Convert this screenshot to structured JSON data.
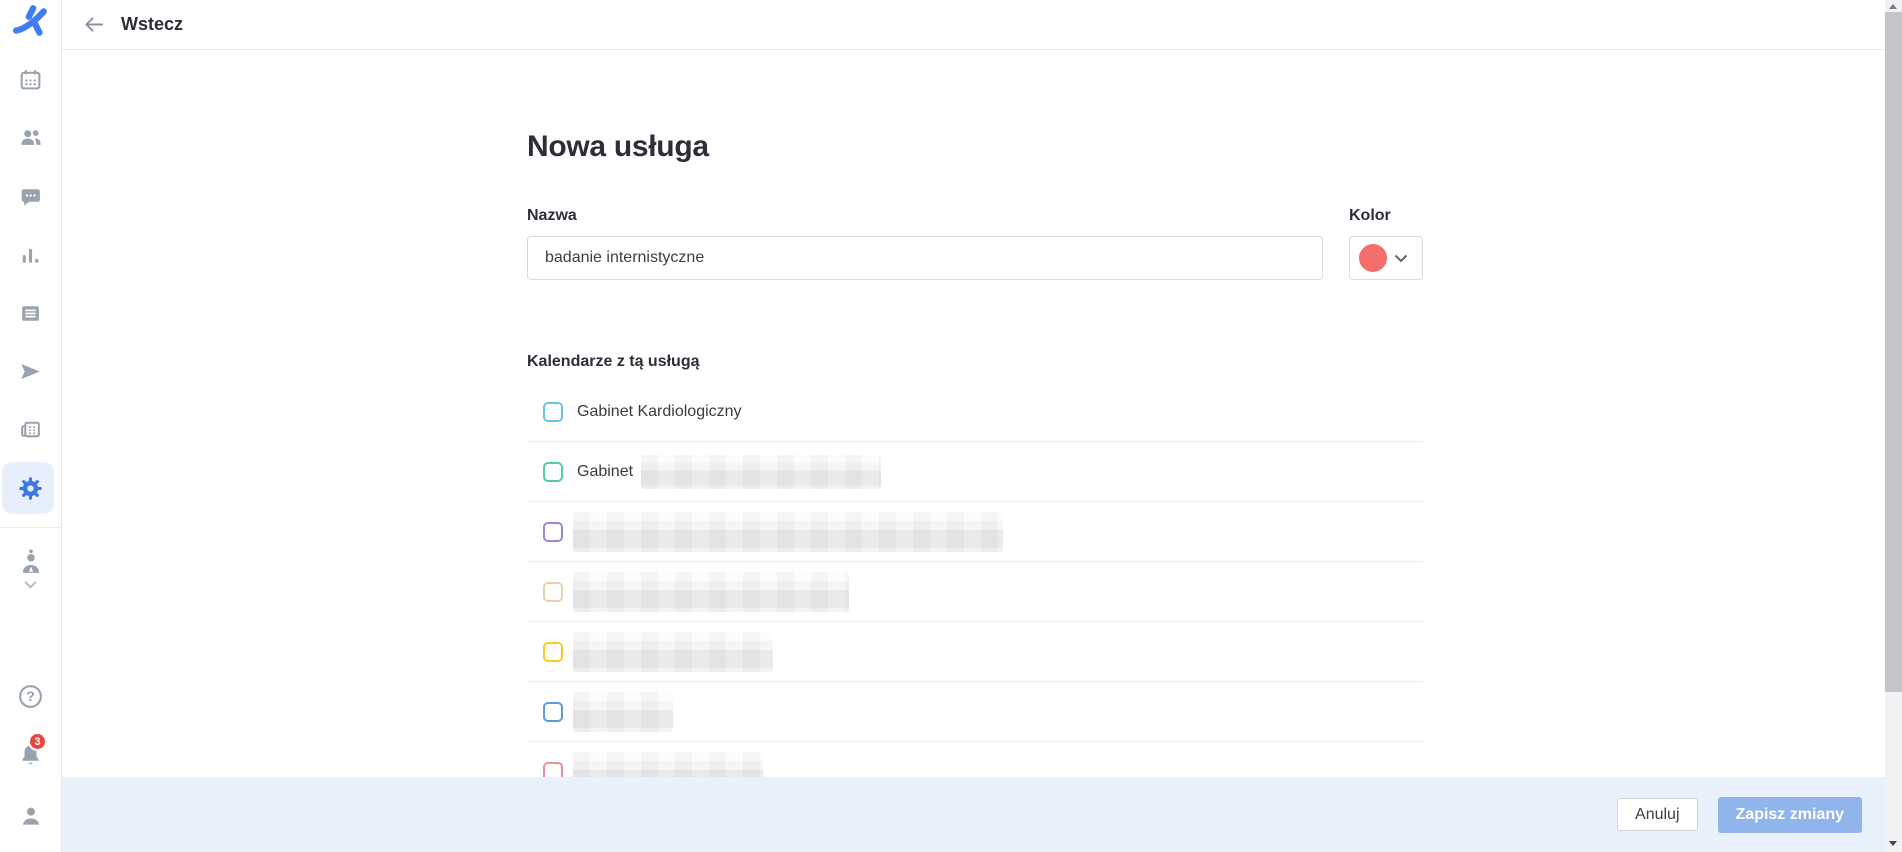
{
  "topbar": {
    "back_label": "Wstecz"
  },
  "sidebar": {
    "notification_badge": "3",
    "icons": [
      "app-logo",
      "calendar-icon",
      "patients-icon",
      "chat-icon",
      "stats-icon",
      "services-icon",
      "send-icon",
      "terminal-icon",
      "settings-icon",
      "doctor-icon",
      "help-icon",
      "notifications-icon",
      "profile-icon"
    ],
    "active_item": "settings"
  },
  "form": {
    "title": "Nowa usługa",
    "name_label": "Nazwa",
    "name_value": "badanie internistyczne",
    "color_label": "Kolor",
    "selected_color": "#f56d6d",
    "color_style": "background:#f56d6d",
    "calendars_label": "Kalendarze z tą usługą",
    "calendars": [
      {
        "label": "Gabinet Kardiologiczny",
        "checked": false,
        "redacted": false,
        "checkbox_color": "#68c5ea",
        "border_style": "border-color:#68c5ea"
      },
      {
        "label": "Gabinet",
        "checked": false,
        "redacted": true,
        "checkbox_color": "#55c9ae",
        "border_style": "border-color:#55c9ae"
      },
      {
        "label": "",
        "checked": false,
        "redacted": true,
        "checkbox_color": "#928cd8",
        "border_style": "border-color:#928cd8"
      },
      {
        "label": "",
        "checked": false,
        "redacted": true,
        "checkbox_color": "#e5d4b2",
        "border_style": "border-color:#e5d4b2"
      },
      {
        "label": "",
        "checked": false,
        "redacted": true,
        "checkbox_color": "#fdc71e",
        "border_style": "border-color:#fdc71e"
      },
      {
        "label": "",
        "checked": false,
        "redacted": true,
        "checkbox_color": "#5b9ce2",
        "border_style": "border-color:#5b9ce2"
      },
      {
        "label": "",
        "checked": false,
        "redacted": true,
        "checkbox_color": "#f28a9b",
        "border_style": "border-color:#f28a9b"
      }
    ]
  },
  "footer": {
    "cancel_label": "Anuluj",
    "save_label": "Zapisz zmiany"
  },
  "colors": {
    "accent_blue": "#3b79e9",
    "active_item_bg": "#e7effc",
    "badge_red": "#e8473f",
    "footer_bg": "#e9f1fc",
    "save_button_bg": "#8fb5ec",
    "icon_gray": "#99a2ad"
  }
}
